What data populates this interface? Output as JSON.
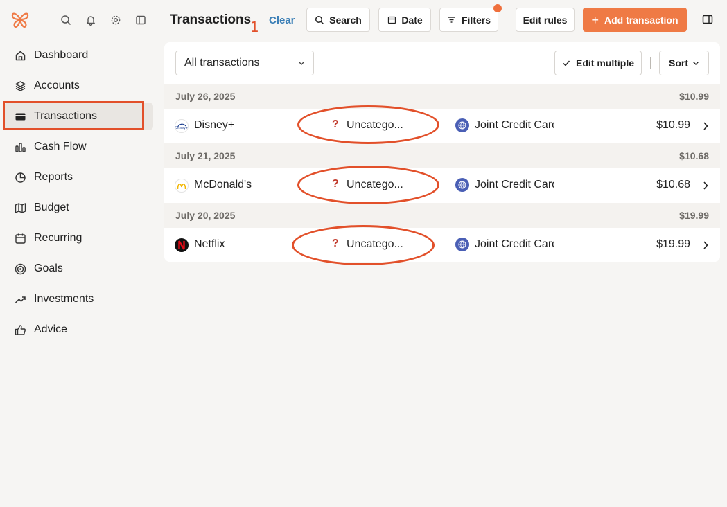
{
  "sidebar": {
    "items": [
      {
        "label": "Dashboard",
        "icon": "home-icon"
      },
      {
        "label": "Accounts",
        "icon": "layers-icon"
      },
      {
        "label": "Transactions",
        "icon": "credit-card-icon"
      },
      {
        "label": "Cash Flow",
        "icon": "bar-chart-icon"
      },
      {
        "label": "Reports",
        "icon": "pie-chart-icon"
      },
      {
        "label": "Budget",
        "icon": "map-icon"
      },
      {
        "label": "Recurring",
        "icon": "calendar-icon"
      },
      {
        "label": "Goals",
        "icon": "target-icon"
      },
      {
        "label": "Investments",
        "icon": "trending-up-icon"
      },
      {
        "label": "Advice",
        "icon": "thumbs-up-icon"
      }
    ]
  },
  "header": {
    "title": "Transactions",
    "annotation": "1",
    "clear_label": "Clear",
    "search_label": "Search",
    "date_label": "Date",
    "filters_label": "Filters",
    "edit_rules_label": "Edit rules",
    "add_label": "Add transaction"
  },
  "toolbar": {
    "select_value": "All transactions",
    "edit_multiple_label": "Edit multiple",
    "sort_label": "Sort"
  },
  "groups": [
    {
      "date": "July 26, 2025",
      "total": "$10.99",
      "transaction": {
        "merchant": "Disney+",
        "category": "Uncatego...",
        "account": "Joint Credit Card",
        "amount": "$10.99"
      }
    },
    {
      "date": "July 21, 2025",
      "total": "$10.68",
      "transaction": {
        "merchant": "McDonald's",
        "category": "Uncatego...",
        "account": "Joint Credit Card",
        "amount": "$10.68"
      }
    },
    {
      "date": "July 20, 2025",
      "total": "$19.99",
      "transaction": {
        "merchant": "Netflix",
        "category": "Uncatego...",
        "account": "Joint Credit Card",
        "amount": "$19.99"
      }
    }
  ],
  "colors": {
    "accent": "#ef7a45",
    "annotation": "#e2502a",
    "link": "#3b7fb6",
    "account_logo": "#4a5fb5"
  }
}
